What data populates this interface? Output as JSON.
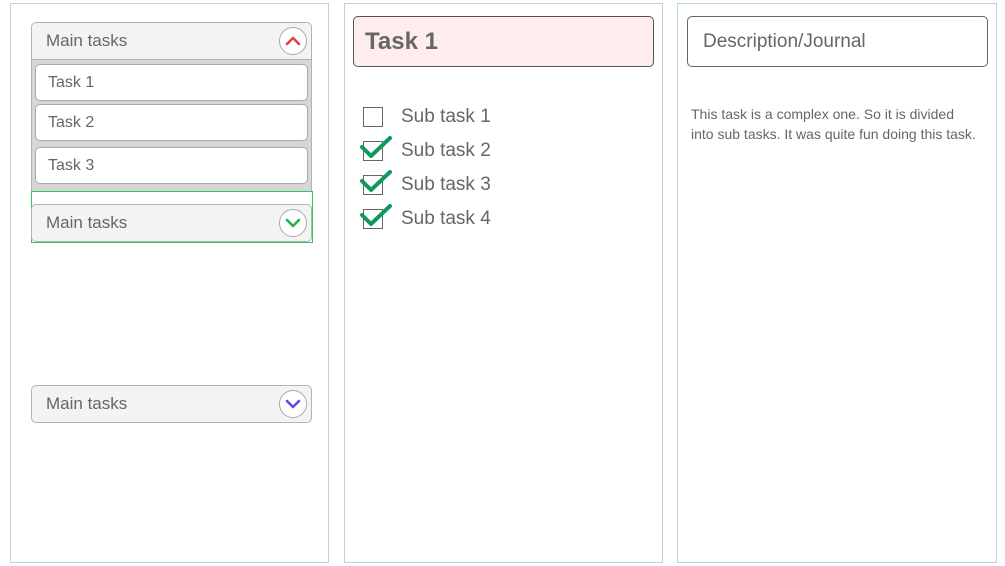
{
  "groups": [
    {
      "label": "Main tasks",
      "expanded": true,
      "toggle_color": "#e0443c",
      "items": [
        {
          "label": "Task 1"
        },
        {
          "label": "Task 2"
        },
        {
          "label": "Task 3"
        }
      ]
    },
    {
      "label": "Main tasks",
      "expanded": false,
      "toggle_color": "#22b347",
      "selected": true
    },
    {
      "label": "Main tasks",
      "expanded": false,
      "toggle_color": "#5b4ee0"
    }
  ],
  "task": {
    "title": "Task 1",
    "subtasks": [
      {
        "label": "Sub task 1",
        "checked": false
      },
      {
        "label": "Sub task 2",
        "checked": true
      },
      {
        "label": "Sub task 3",
        "checked": true
      },
      {
        "label": "Sub task 4",
        "checked": true
      }
    ],
    "check_color": "#0e9a5a"
  },
  "description": {
    "title": "Description/Journal",
    "text": "This task is a complex one. So it is divided into sub tasks. It was quite fun doing this task."
  },
  "icons": {
    "expanded_toggle": "chevron-up-icon",
    "collapsed_toggle": "chevron-down-icon",
    "checkmark": "checkmark-icon"
  }
}
